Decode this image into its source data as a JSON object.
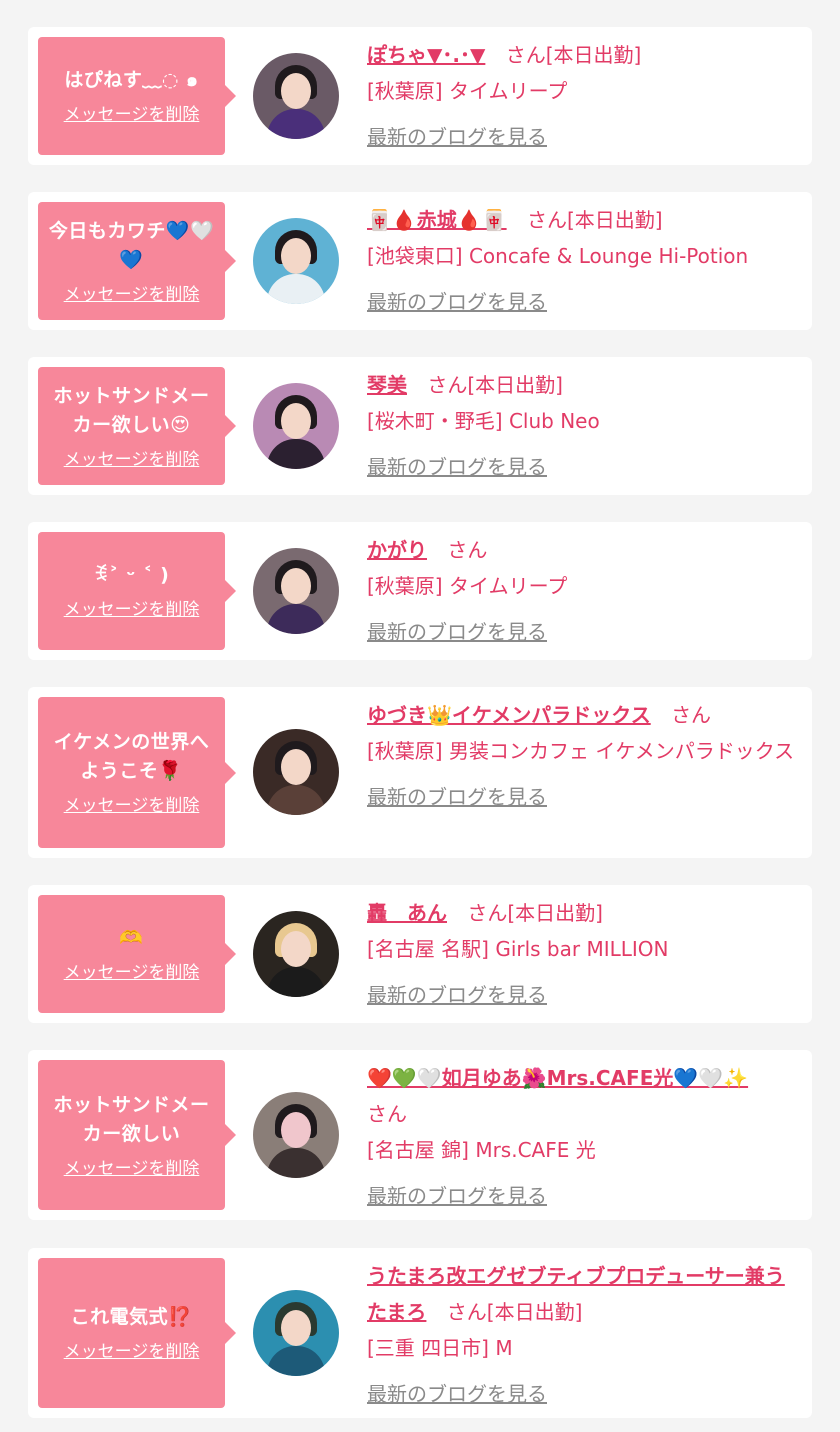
{
  "entries": [
    {
      "message": "はぴねす﹏◌ ๑",
      "delete_label": "メッセージを削除",
      "cast_name": "ぽちゃ▼･.･▼",
      "suffix": "さん[本日出勤]",
      "shop": "[秋葉原] タイムリープ",
      "blog_label": "最新のブログを見る"
    },
    {
      "message": "今日もカワチ💙🤍💙",
      "delete_label": "メッセージを削除",
      "cast_name": "🀄🩸赤城🩸🀄",
      "suffix": "さん[本日出勤]",
      "shop": "[池袋東口] Concafe & Lounge Hi-Potion",
      "blog_label": "最新のブログを見る"
    },
    {
      "message": "ホットサンドメーカー欲しい😍",
      "delete_label": "メッセージを削除",
      "cast_name": "琴美",
      "suffix": "さん[本日出勤]",
      "shop": "[桜木町・野毛] Club Neo",
      "blog_label": "最新のブログを見る"
    },
    {
      "message": "ꉂ˃ ᵕ ˂ )",
      "delete_label": "メッセージを削除",
      "cast_name": "かがり",
      "suffix": "さん",
      "shop": "[秋葉原] タイムリープ",
      "blog_label": "最新のブログを見る"
    },
    {
      "message": "イケメンの世界へようこそ🌹",
      "delete_label": "メッセージを削除",
      "cast_name": "ゆづき👑イケメンパラドックス",
      "suffix": "さん",
      "shop": "[秋葉原] 男装コンカフェ イケメンパラドックス",
      "blog_label": "最新のブログを見る"
    },
    {
      "message": "🫶",
      "delete_label": "メッセージを削除",
      "cast_name": "轟　あん",
      "suffix": "さん[本日出勤]",
      "shop": "[名古屋 名駅] Girls bar MILLION",
      "blog_label": "最新のブログを見る"
    },
    {
      "message": "ホットサンドメーカー欲しい",
      "delete_label": "メッセージを削除",
      "cast_name": "❤️💚🤍如月ゆあ🌺Mrs.CAFE光💙🤍✨",
      "suffix": "さん",
      "shop": "[名古屋 錦] Mrs.CAFE 光",
      "blog_label": "最新のブログを見る"
    },
    {
      "message": "これ電気式⁉️",
      "delete_label": "メッセージを削除",
      "cast_name": "うたまろ改エグゼブティブプロデューサー兼うたまろ",
      "suffix": "さん[本日出勤]",
      "shop": "[三重 四日市] M",
      "blog_label": "最新のブログを見る"
    }
  ],
  "colors": {
    "background": "#f4f4f4",
    "card": "#ffffff",
    "bubble": "#f7879a",
    "accent": "#e23b66",
    "muted_link": "#8a8a8a"
  }
}
